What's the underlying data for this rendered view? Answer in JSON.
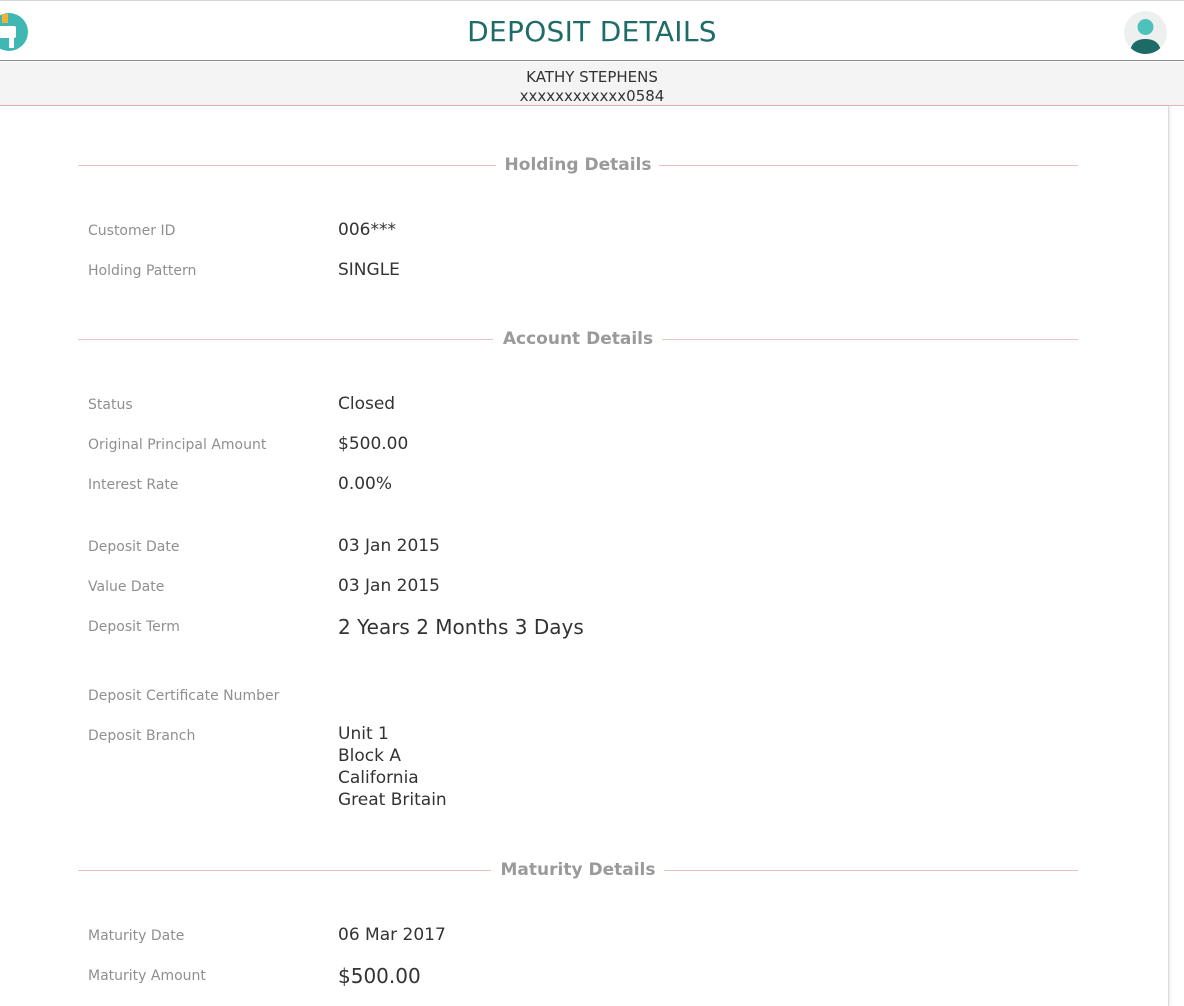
{
  "header": {
    "title": "DEPOSIT DETAILS"
  },
  "account_banner": {
    "name": "KATHY STEPHENS",
    "account_number": "xxxxxxxxxxxx0584"
  },
  "sections": {
    "holding": {
      "title": "Holding Details",
      "customer_id_label": "Customer ID",
      "customer_id_value": "006***",
      "holding_pattern_label": "Holding Pattern",
      "holding_pattern_value": "SINGLE"
    },
    "account": {
      "title": "Account Details",
      "status_label": "Status",
      "status_value": "Closed",
      "principal_label": "Original Principal Amount",
      "principal_value": "$500.00",
      "interest_label": "Interest Rate",
      "interest_value": "0.00%",
      "deposit_date_label": "Deposit Date",
      "deposit_date_value": "03 Jan 2015",
      "value_date_label": "Value Date",
      "value_date_value": "03 Jan 2015",
      "term_label": "Deposit Term",
      "term_value": "2 Years 2 Months 3 Days",
      "certificate_label": "Deposit Certificate Number",
      "branch_label": "Deposit Branch",
      "branch_lines": [
        "Unit 1",
        "Block A",
        "California",
        "Great Britain"
      ]
    },
    "maturity": {
      "title": "Maturity Details",
      "maturity_date_label": "Maturity Date",
      "maturity_date_value": "06 Mar 2017",
      "maturity_amount_label": "Maturity Amount",
      "maturity_amount_value": "$500.00"
    }
  },
  "icons": {
    "logo": "bank-logo-icon",
    "avatar": "user-avatar-icon"
  },
  "colors": {
    "title_teal": "#1e6b68",
    "section_rule": "#ebc2bd",
    "label_gray": "#8f8f8f"
  }
}
